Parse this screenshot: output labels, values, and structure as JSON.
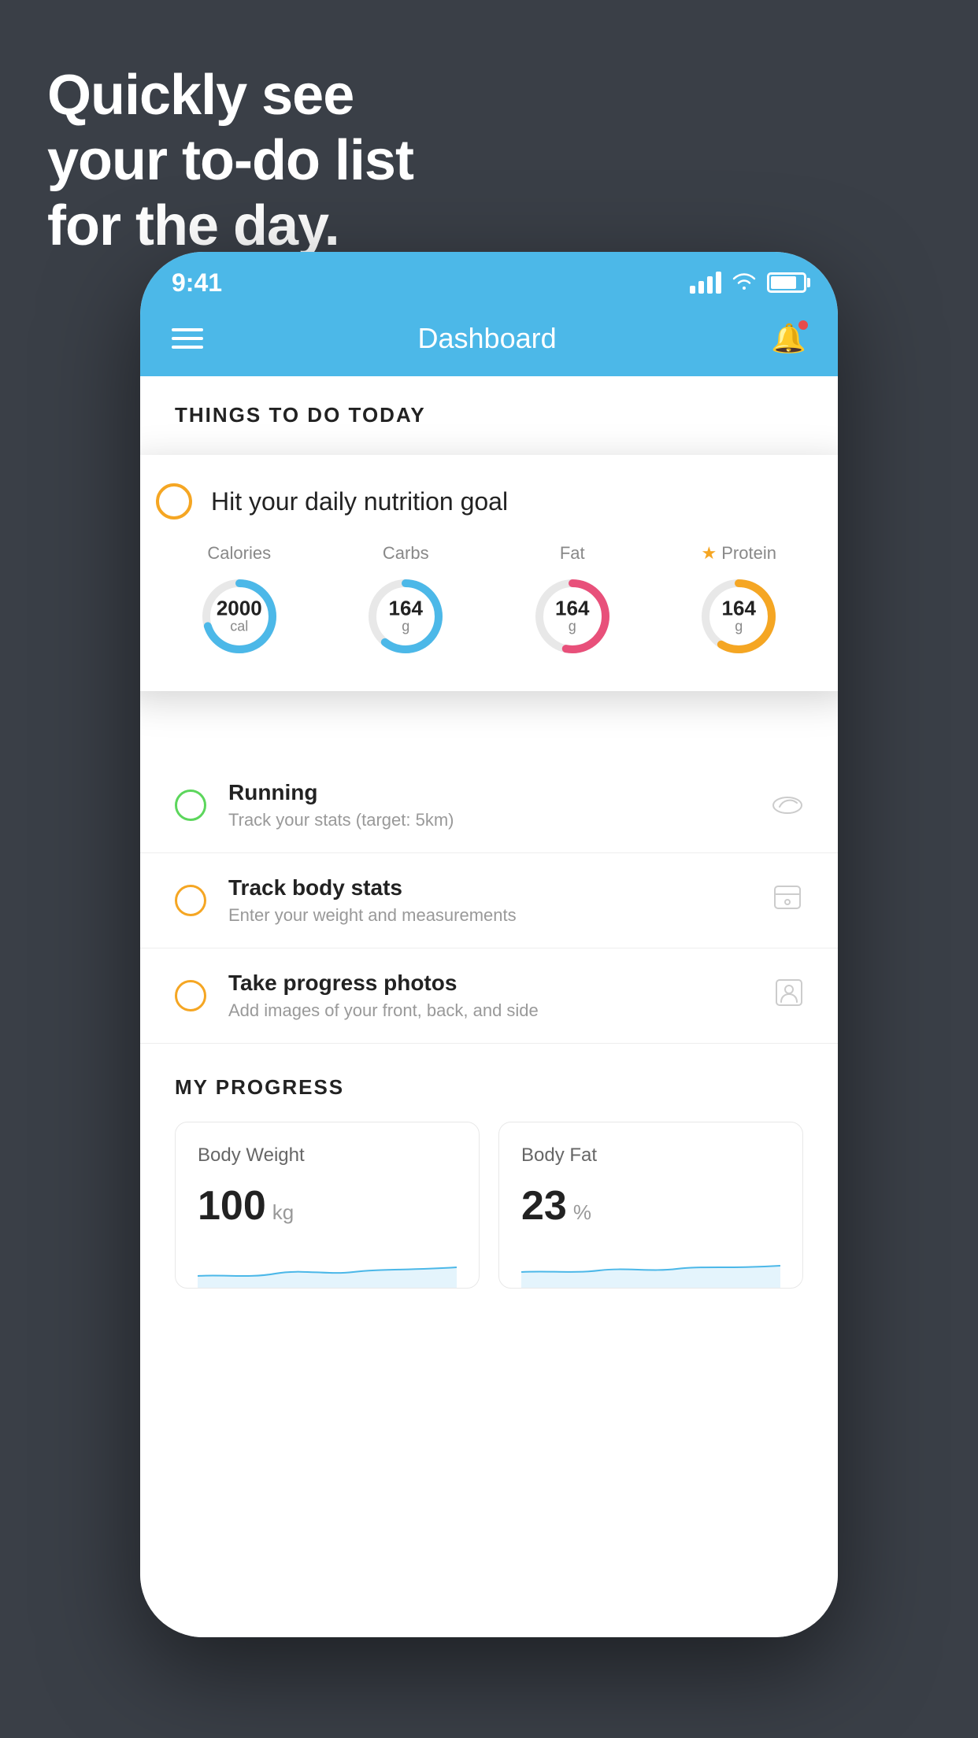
{
  "hero": {
    "headline_line1": "Quickly see",
    "headline_line2": "your to-do list",
    "headline_line3": "for the day."
  },
  "status_bar": {
    "time": "9:41"
  },
  "header": {
    "title": "Dashboard"
  },
  "things_today": {
    "section_label": "THINGS TO DO TODAY"
  },
  "nutrition_card": {
    "title": "Hit your daily nutrition goal",
    "labels": {
      "calories": "Calories",
      "carbs": "Carbs",
      "fat": "Fat",
      "protein": "Protein"
    },
    "values": {
      "calories_value": "2000",
      "calories_unit": "cal",
      "carbs_value": "164",
      "carbs_unit": "g",
      "fat_value": "164",
      "fat_unit": "g",
      "protein_value": "164",
      "protein_unit": "g"
    },
    "colors": {
      "calories": "#4cb8e8",
      "carbs": "#4cb8e8",
      "fat": "#e8507a",
      "protein": "#f5a623"
    }
  },
  "todo_items": [
    {
      "id": "running",
      "circle_color": "green",
      "title": "Running",
      "subtitle": "Track your stats (target: 5km)"
    },
    {
      "id": "body-stats",
      "circle_color": "yellow",
      "title": "Track body stats",
      "subtitle": "Enter your weight and measurements"
    },
    {
      "id": "progress-photos",
      "circle_color": "yellow",
      "title": "Take progress photos",
      "subtitle": "Add images of your front, back, and side"
    }
  ],
  "progress": {
    "section_label": "MY PROGRESS",
    "cards": [
      {
        "id": "body-weight",
        "title": "Body Weight",
        "value": "100",
        "unit": "kg"
      },
      {
        "id": "body-fat",
        "title": "Body Fat",
        "value": "23",
        "unit": "%"
      }
    ]
  }
}
